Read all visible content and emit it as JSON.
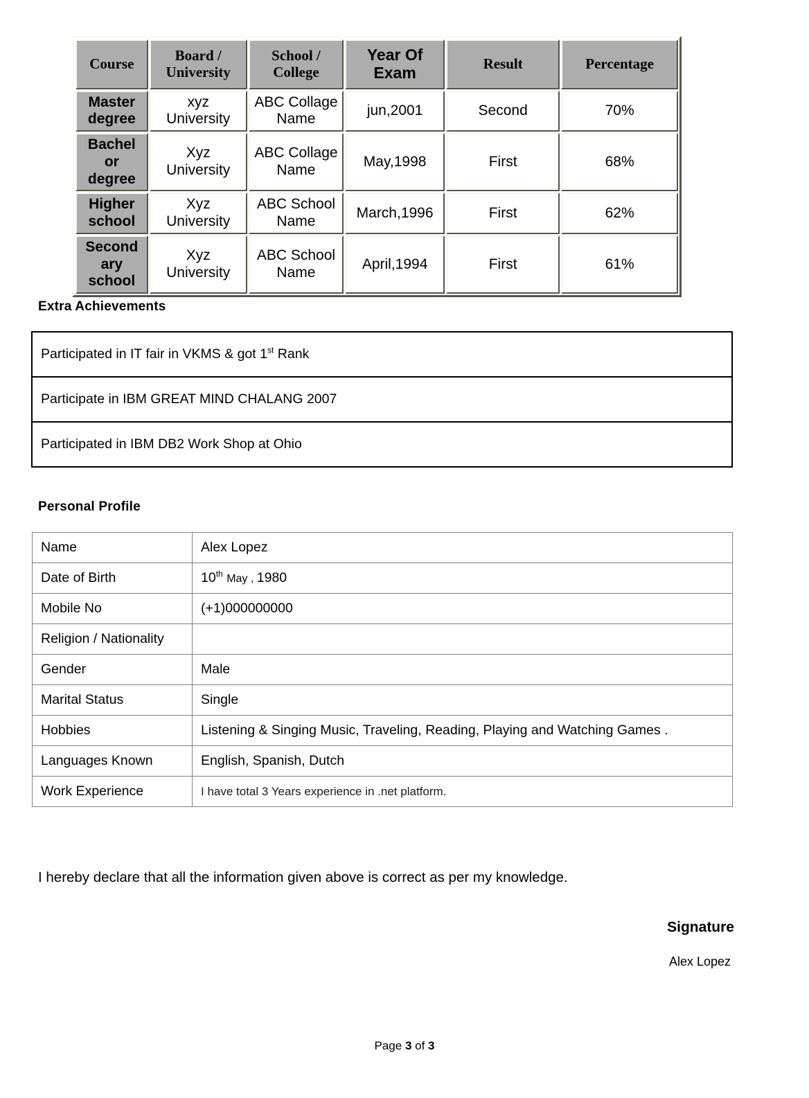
{
  "education_table": {
    "headers": [
      {
        "line1": "Course",
        "line2": "",
        "style": "serif"
      },
      {
        "line1": "Board /",
        "line2": "University",
        "style": "serif"
      },
      {
        "line1": "School /",
        "line2": "College",
        "style": "serif"
      },
      {
        "line1": "Year Of",
        "line2": "Exam",
        "style": "sans"
      },
      {
        "line1": "Result",
        "line2": "",
        "style": "serif"
      },
      {
        "line1": "Percentage",
        "line2": "",
        "style": "serif"
      }
    ],
    "rows": [
      {
        "course": "Master degree",
        "board": "xyz University",
        "school": "ABC Collage Name",
        "year": "jun,2001",
        "result": "Second",
        "percentage": "70%"
      },
      {
        "course": "Bachel or degree",
        "board": "Xyz University",
        "school": "ABC Collage Name",
        "year": "May,1998",
        "result": "First",
        "percentage": "68%"
      },
      {
        "course": "Higher school",
        "board": "Xyz University",
        "school": "ABC School Name",
        "year": "March,1996",
        "result": "First",
        "percentage": "62%"
      },
      {
        "course": "Second ary school",
        "board": "Xyz University",
        "school": "ABC School Name",
        "year": "April,1994",
        "result": "First",
        "percentage": "61%"
      }
    ]
  },
  "extra_achievements": {
    "heading": "Extra Achievements",
    "items": [
      {
        "prefix": "Participated in IT fair in VKMS & got 1",
        "ordinal": "st",
        "suffix": " Rank"
      },
      {
        "prefix": "Participate in IBM GREAT MIND CHALANG 2007",
        "ordinal": "",
        "suffix": ""
      },
      {
        "prefix": "Participated in IBM DB2 Work Shop at Ohio",
        "ordinal": "",
        "suffix": ""
      }
    ]
  },
  "personal_profile": {
    "heading": "Personal Profile",
    "rows": [
      {
        "label": "Name",
        "value": "Alex Lopez",
        "small": false
      },
      {
        "label": "Date of Birth",
        "value": "10th May , 1980",
        "small": false,
        "dob": {
          "day": "10",
          "ordinal": "th",
          "month": "May , ",
          "year": "1980"
        }
      },
      {
        "label": "Mobile No",
        "value": "(+1)000000000",
        "small": false
      },
      {
        "label": "Religion / Nationality",
        "value": "",
        "small": false
      },
      {
        "label": "Gender",
        "value": "Male",
        "small": false
      },
      {
        "label": "Marital Status",
        "value": "Single",
        "small": false
      },
      {
        "label": "Hobbies",
        "value": "Listening & Singing Music, Traveling, Reading, Playing and Watching Games .",
        "small": false
      },
      {
        "label": "Languages Known",
        "value": "English, Spanish, Dutch",
        "small": false
      },
      {
        "label": "Work Experience",
        "value": "I have total 3 Years experience in .net platform.",
        "small": true
      }
    ]
  },
  "declaration": "I hereby declare that all the information given above is correct as per my knowledge.",
  "signature": {
    "title": "Signature",
    "name": "Alex Lopez"
  },
  "footer": {
    "prefix": "Page ",
    "current": "3",
    "middle": " of ",
    "total": "3"
  },
  "colors": {
    "header_gray": "#adadad",
    "achievement_border": "#000000",
    "profile_border": "#808080",
    "page_background": "#ffffff"
  }
}
